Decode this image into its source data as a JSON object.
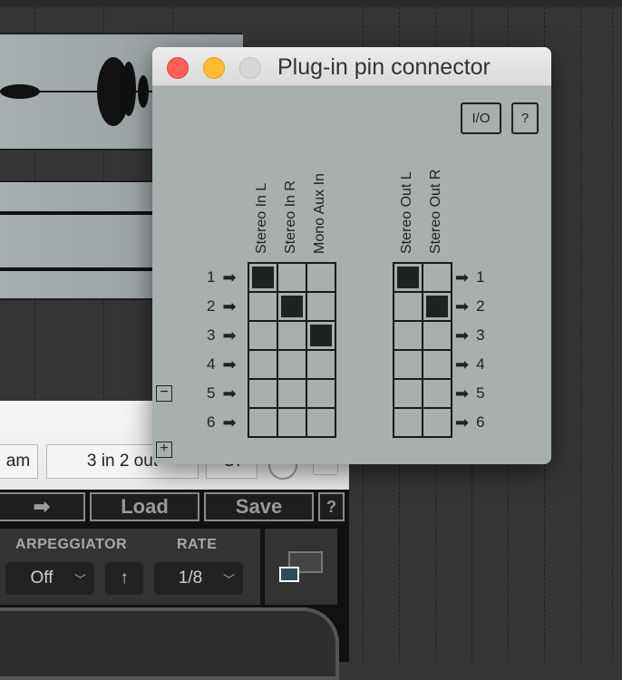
{
  "dialog": {
    "title": "Plug-in pin connector",
    "io_button": "I/O",
    "help_button": "?",
    "inputs": [
      "Stereo In L",
      "Stereo In R",
      "Mono Aux In"
    ],
    "outputs": [
      "Stereo Out L",
      "Stereo Out R"
    ],
    "rows": [
      "1",
      "2",
      "3",
      "4",
      "5",
      "6"
    ],
    "input_matrix": [
      [
        1,
        0,
        0
      ],
      [
        0,
        1,
        0
      ],
      [
        0,
        0,
        1
      ],
      [
        0,
        0,
        0
      ],
      [
        0,
        0,
        0
      ],
      [
        0,
        0,
        0
      ]
    ],
    "output_matrix": [
      [
        1,
        0
      ],
      [
        0,
        1
      ],
      [
        0,
        0
      ],
      [
        0,
        0
      ],
      [
        0,
        0
      ],
      [
        0,
        0
      ]
    ],
    "minus_label": "−",
    "plus_label": "+"
  },
  "plugin_header": {
    "field1": "am",
    "io_config": "3 in 2 out",
    "field3": "Of"
  },
  "plugin_toolbar": {
    "arrow": "➡",
    "load": "Load",
    "save": "Save",
    "help": "?"
  },
  "arpeggiator": {
    "label": "ARPEGGIATOR",
    "value": "Off",
    "direction": "↑",
    "rate_label": "RATE",
    "rate_value": "1/8"
  },
  "colors": {
    "close": "#fe5f57",
    "minimize": "#febc2e",
    "zoom": "#d6d6d6",
    "accent": "#2e4d55"
  }
}
